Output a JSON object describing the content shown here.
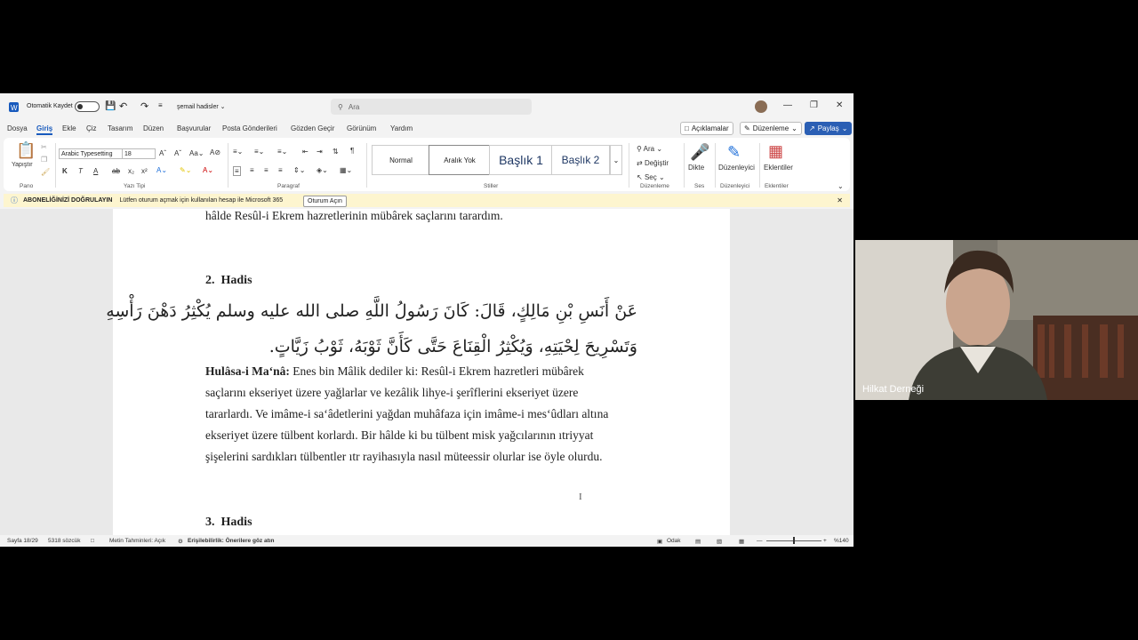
{
  "titlebar": {
    "autosave_label": "Otomatik Kaydet",
    "doc_title": "şemail hadisler",
    "search_placeholder": "Ara"
  },
  "menu": [
    "Dosya",
    "Giriş",
    "Ekle",
    "Çiz",
    "Tasarım",
    "Düzen",
    "Başvurular",
    "Posta Gönderileri",
    "Gözden Geçir",
    "Görünüm",
    "Yardım"
  ],
  "top_buttons": {
    "comments": "Açıklamalar",
    "editing": "Düzenleme",
    "share": "Paylaş"
  },
  "ribbon": {
    "paste_label": "Yapıştır",
    "font_name": "Arabic Typesetting",
    "font_size": "18",
    "styles": [
      "Normal",
      "Aralık Yok",
      "Başlık 1",
      "Başlık 2"
    ],
    "find": "Ara",
    "replace": "Değiştir",
    "select": "Seç",
    "dictate": "Dikte",
    "editor": "Düzenleyici",
    "addins": "Eklentiler",
    "groups": {
      "clipboard": "Pano",
      "font": "Yazı Tipi",
      "paragraph": "Paragraf",
      "styles": "Stiller",
      "editing": "Düzenleme",
      "voice": "Ses",
      "editor": "Düzenleyici",
      "addins": "Eklentiler"
    }
  },
  "notification": {
    "title": "ABONELİĞİNİZİ DOĞRULAYIN",
    "message": "Lütfen oturum açmak için kullanılan hesap ile Microsoft 365",
    "button": "Oturum Açın"
  },
  "document": {
    "prev_line": "hâlde Resûl-i Ekrem hazretlerinin mübârek saçlarını tarardım.",
    "heading2_num": "2.",
    "heading2": "Hadis",
    "arabic_line1": "عَنْ أَنَسِ بْنِ مَالِكٍ، قَالَ: كَانَ رَسُولُ اللَّهِ صلى الله عليه وسلم يُكْثِرُ دَهْنَ رَأْسِهِ",
    "arabic_line2": "وَتَسْرِيحَ لِحْيَتِهِ، وَيُكْثِرُ الْقِنَاعَ حَتَّى كَأَنَّ ثَوْبَهُ، ثَوْبُ زَيَّاتٍ.",
    "summary_label": "Hulâsa-i Ma‘nâ:",
    "summary_lines": [
      " Enes bin Mâlik dediler ki: Resûl-i Ekrem hazretleri mübârek",
      "saçlarını ekseriyet üzere yağlarlar ve kezâlik lihye-i şerîflerini ekseriyet üzere",
      "tararlardı. Ve imâme-i sa‘âdetlerini yağdan muhâfaza için imâme-i mes‘ûdları altına",
      "ekseriyet üzere tülbent korlardı. Bir hâlde ki bu tülbent misk yağcılarının ıtriyyat",
      "şişelerini sardıkları tülbentler ıtr rayihasıyla nasıl müteessir olurlar ise öyle olurdu."
    ],
    "heading3_num": "3.",
    "heading3": "Hadis"
  },
  "statusbar": {
    "page": "Sayfa 18/29",
    "words": "5318 sözcük",
    "predictions": "Metin Tahminleri: Açık",
    "accessibility": "Erişilebilirlik: Önerilere göz atın",
    "focus": "Odak",
    "zoom": "%140"
  },
  "video": {
    "name": "Hilkat Derneği"
  },
  "colors": {
    "accent": "#185abd",
    "share": "#2b5fb4",
    "notif": "#fdf5cf"
  }
}
